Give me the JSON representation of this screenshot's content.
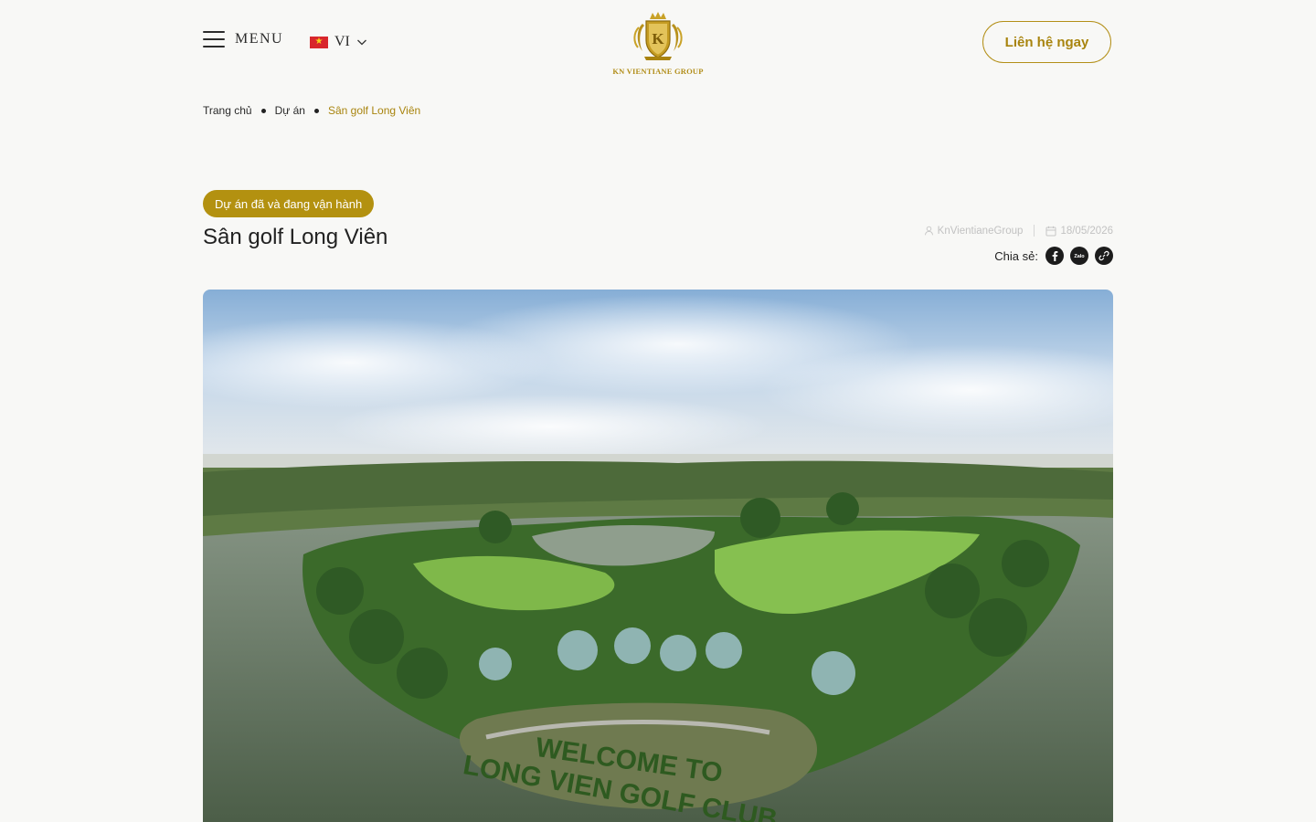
{
  "header": {
    "menu_label": "MENU",
    "language": "VI",
    "logo_text": "KN VIENTIANE GROUP",
    "contact_label": "Liên hệ ngay"
  },
  "breadcrumb": [
    "Trang chủ",
    "Dự án",
    "Sân golf Long Viên"
  ],
  "article": {
    "category": "Dự án đã và đang vận hành",
    "title": "Sân golf Long Viên",
    "author": "KnVientianeGroup",
    "date": "18/05/2026",
    "share_label": "Chia sẻ:"
  },
  "hero": {
    "sign_line1": "WELCOME TO",
    "sign_line2": "LONG VIEN GOLF CLUB"
  },
  "colors": {
    "accent": "#b39110",
    "background": "#f8f8f6",
    "text": "#222222"
  },
  "icons": [
    "menu-icon",
    "flag-vn-icon",
    "chevron-down-icon",
    "user-icon",
    "calendar-icon",
    "facebook-icon",
    "zalo-icon",
    "link-icon"
  ]
}
